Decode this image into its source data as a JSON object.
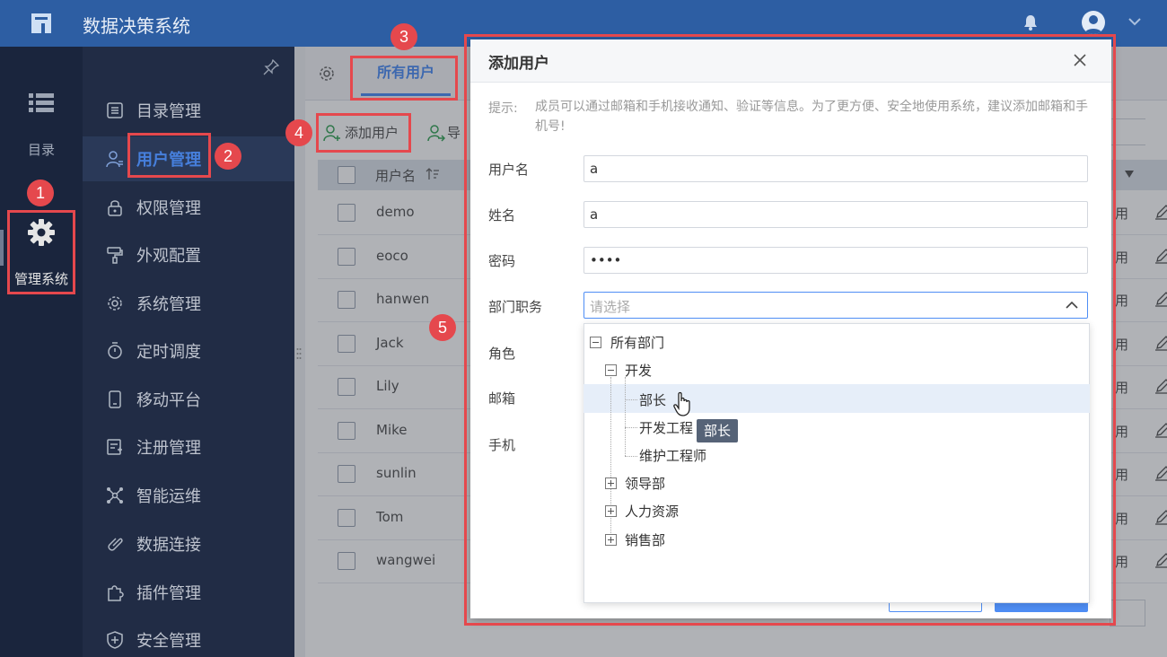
{
  "app": {
    "title": "数据决策系统"
  },
  "rail": {
    "catalog_label": "目录",
    "admin_label": "管理系统"
  },
  "menu": {
    "items": [
      {
        "label": "目录管理",
        "icon": "list-icon"
      },
      {
        "label": "用户管理",
        "icon": "user-icon",
        "active": true
      },
      {
        "label": "权限管理",
        "icon": "lock-icon"
      },
      {
        "label": "外观配置",
        "icon": "paint-roller-icon"
      },
      {
        "label": "系统管理",
        "icon": "gear-icon"
      },
      {
        "label": "定时调度",
        "icon": "timer-icon"
      },
      {
        "label": "移动平台",
        "icon": "mobile-icon"
      },
      {
        "label": "注册管理",
        "icon": "register-icon"
      },
      {
        "label": "智能运维",
        "icon": "network-icon"
      },
      {
        "label": "数据连接",
        "icon": "link-icon"
      },
      {
        "label": "插件管理",
        "icon": "puzzle-icon"
      },
      {
        "label": "安全管理",
        "icon": "shield-icon"
      }
    ]
  },
  "tabs": {
    "all_users": "所有用户"
  },
  "toolbar": {
    "add_user": "添加用户",
    "import_partial": "导"
  },
  "table": {
    "header_username": "用户名",
    "rows": [
      {
        "name": "demo",
        "status": "用"
      },
      {
        "name": "eoco",
        "status": "用"
      },
      {
        "name": "hanwen",
        "status": "用"
      },
      {
        "name": "Jack",
        "status": "用"
      },
      {
        "name": "Lily",
        "status": "用"
      },
      {
        "name": "Mike",
        "status": "用"
      },
      {
        "name": "sunlin",
        "status": "用"
      },
      {
        "name": "Tom",
        "status": "用"
      },
      {
        "name": "wangwei",
        "status": "用"
      }
    ]
  },
  "dialog": {
    "title": "添加用户",
    "hint_label": "提示:",
    "hint_text": "成员可以通过邮箱和手机接收通知、验证等信息。为了更方便、安全地使用系统，建议添加邮箱和手机号!",
    "fields": {
      "username": {
        "label": "用户名",
        "value": "a"
      },
      "realname": {
        "label": "姓名",
        "value": "a"
      },
      "password": {
        "label": "密码",
        "value": "••••"
      },
      "dept": {
        "label": "部门职务",
        "placeholder": "请选择"
      },
      "role": {
        "label": "角色"
      },
      "email": {
        "label": "邮箱"
      },
      "phone": {
        "label": "手机"
      }
    }
  },
  "tree": {
    "root": "所有部门",
    "dev": "开发",
    "dev_children": [
      "部长",
      "开发工程",
      "维护工程师"
    ],
    "others": [
      "领导部",
      "人力资源",
      "销售部"
    ],
    "tooltip": "部长"
  },
  "annotations": [
    "1",
    "2",
    "3",
    "4",
    "5"
  ],
  "colors": {
    "topbar": "#2d5ea3",
    "accent": "#4f8ef5",
    "annotation": "#e5484d",
    "rail": "#1d2a44",
    "menu": "#25324d"
  }
}
